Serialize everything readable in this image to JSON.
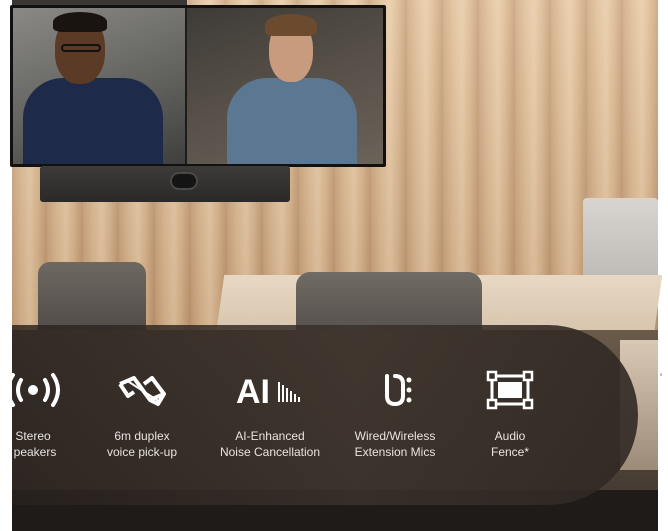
{
  "features": [
    {
      "icon": "stereo-speakers-icon",
      "label_line1": "Stereo",
      "label_line2": "peakers"
    },
    {
      "icon": "duplex-voice-icon",
      "label_line1": "6m duplex",
      "label_line2": "voice pick-up"
    },
    {
      "icon": "ai-icon",
      "icon_text": "AI",
      "label_line1": "AI-Enhanced",
      "label_line2": "Noise Cancellation"
    },
    {
      "icon": "extension-mics-icon",
      "label_line1": "Wired/Wireless",
      "label_line2": "Extension Mics"
    },
    {
      "icon": "audio-fence-icon",
      "label_line1": "Audio",
      "label_line2": "Fence*"
    }
  ],
  "colors": {
    "band": "#3a312b",
    "label": "#e9e4df",
    "icon": "#ffffff"
  }
}
